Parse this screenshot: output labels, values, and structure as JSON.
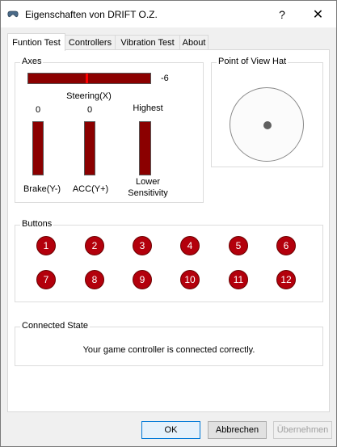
{
  "window": {
    "title": "Eigenschaften von DRIFT O.Z.",
    "help_label": "?",
    "close_label": "✕"
  },
  "tabs": [
    {
      "label": "Funtion Test",
      "active": true
    },
    {
      "label": "Controllers",
      "active": false
    },
    {
      "label": "Vibration Test",
      "active": false
    },
    {
      "label": "About",
      "active": false
    }
  ],
  "axes": {
    "legend": "Axes",
    "steering": {
      "value": "-6",
      "label": "Steering(X)"
    },
    "brake": {
      "value": "0",
      "label": "Brake(Y-)"
    },
    "acc": {
      "value": "0",
      "label": "ACC(Y+)"
    },
    "sensitivity": {
      "top_label": "Highest",
      "bottom_label_1": "Lower",
      "bottom_label_2": "Sensitivity"
    }
  },
  "pov": {
    "legend": "Point of View Hat"
  },
  "buttons": {
    "legend": "Buttons",
    "items": [
      "1",
      "2",
      "3",
      "4",
      "5",
      "6",
      "7",
      "8",
      "9",
      "10",
      "11",
      "12"
    ],
    "color": "#b3000c"
  },
  "connected": {
    "legend": "Connected State",
    "message": "Your game controller is connected correctly."
  },
  "footer": {
    "ok": "OK",
    "cancel": "Abbrechen",
    "apply": "Übernehmen"
  }
}
